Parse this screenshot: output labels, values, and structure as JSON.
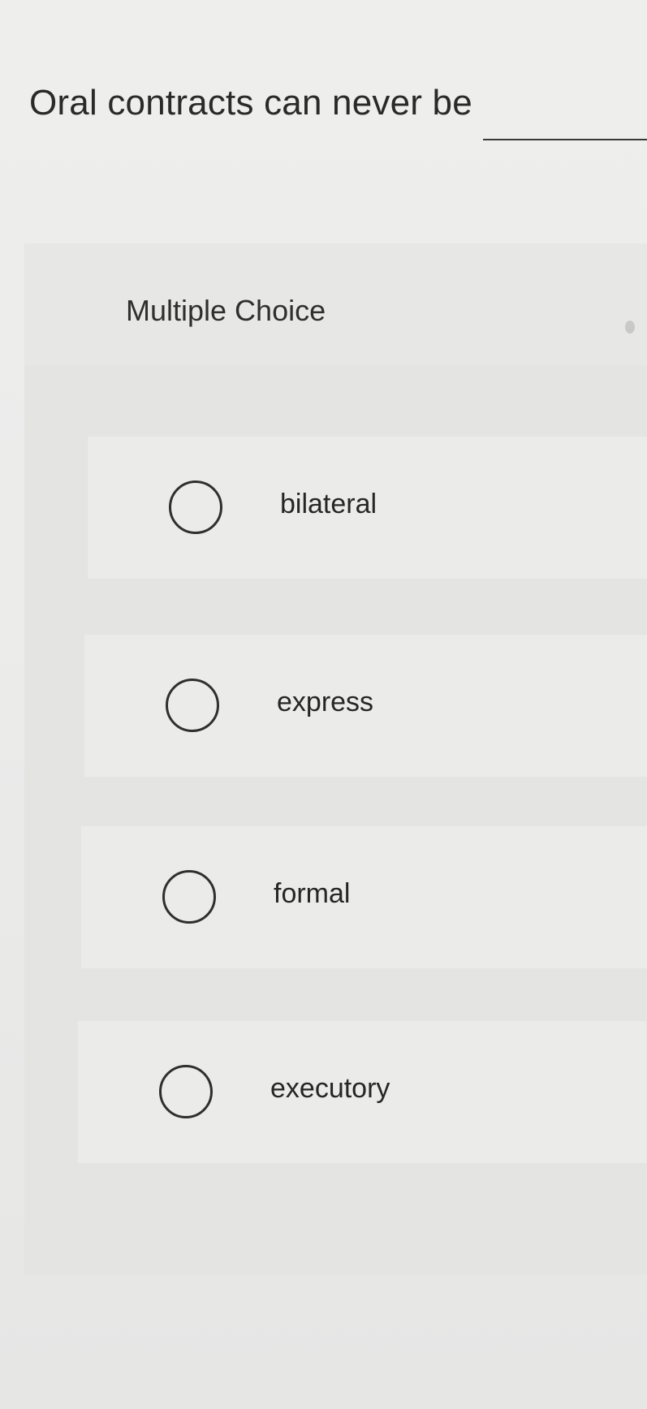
{
  "question": {
    "text": "Oral contracts can never be"
  },
  "panel": {
    "type_label": "Multiple Choice",
    "options": [
      {
        "label": "bilateral"
      },
      {
        "label": "express"
      },
      {
        "label": "formal"
      },
      {
        "label": "executory"
      }
    ]
  },
  "colors": {
    "background": "#ececeb",
    "panel": "#e4e4e3",
    "option_card": "#ebebea",
    "text": "#2a2a2a"
  }
}
